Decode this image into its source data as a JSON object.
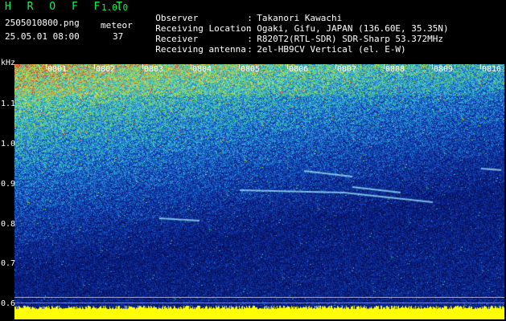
{
  "header": {
    "app_title": "H R O F F T",
    "app_version": "1.0.0",
    "filename": "2505010800.png",
    "datetime": "25.05.01 08:00",
    "mode_label": "meteor",
    "count": "37"
  },
  "info": [
    {
      "key": "Observer",
      "sep": ":",
      "value": "Takanori Kawachi"
    },
    {
      "key": "Receiving Location",
      "sep": ":",
      "value": "Ogaki, Gifu, JAPAN (136.60E, 35.35N)"
    },
    {
      "key": "Receiver",
      "sep": ":",
      "value": "R820T2(RTL-SDR) SDR-Sharp 53.372MHz"
    },
    {
      "key": "Receiving antenna",
      "sep": ":",
      "value": "2el-HB9CV Vertical (el. E-W)"
    }
  ],
  "axis": {
    "unit": "kHz",
    "y_ticks": [
      "1.1",
      "1.0",
      "0.9",
      "0.8",
      "0.7",
      "0.6"
    ],
    "x_ticks": [
      "0801",
      "0802",
      "0803",
      "0804",
      "0805",
      "0806",
      "0807",
      "0808",
      "0809",
      "0810"
    ]
  },
  "colors": {
    "background": "#000000",
    "title": "#00ff55",
    "noise_low": "#0a1f8a",
    "noise_mid": "#1f7fdc",
    "noise_high": "#e6e63a",
    "noise_peak": "#e43a3a",
    "bottom_band": "#ffff00",
    "meteor_trace": "#9ff0ff"
  }
}
